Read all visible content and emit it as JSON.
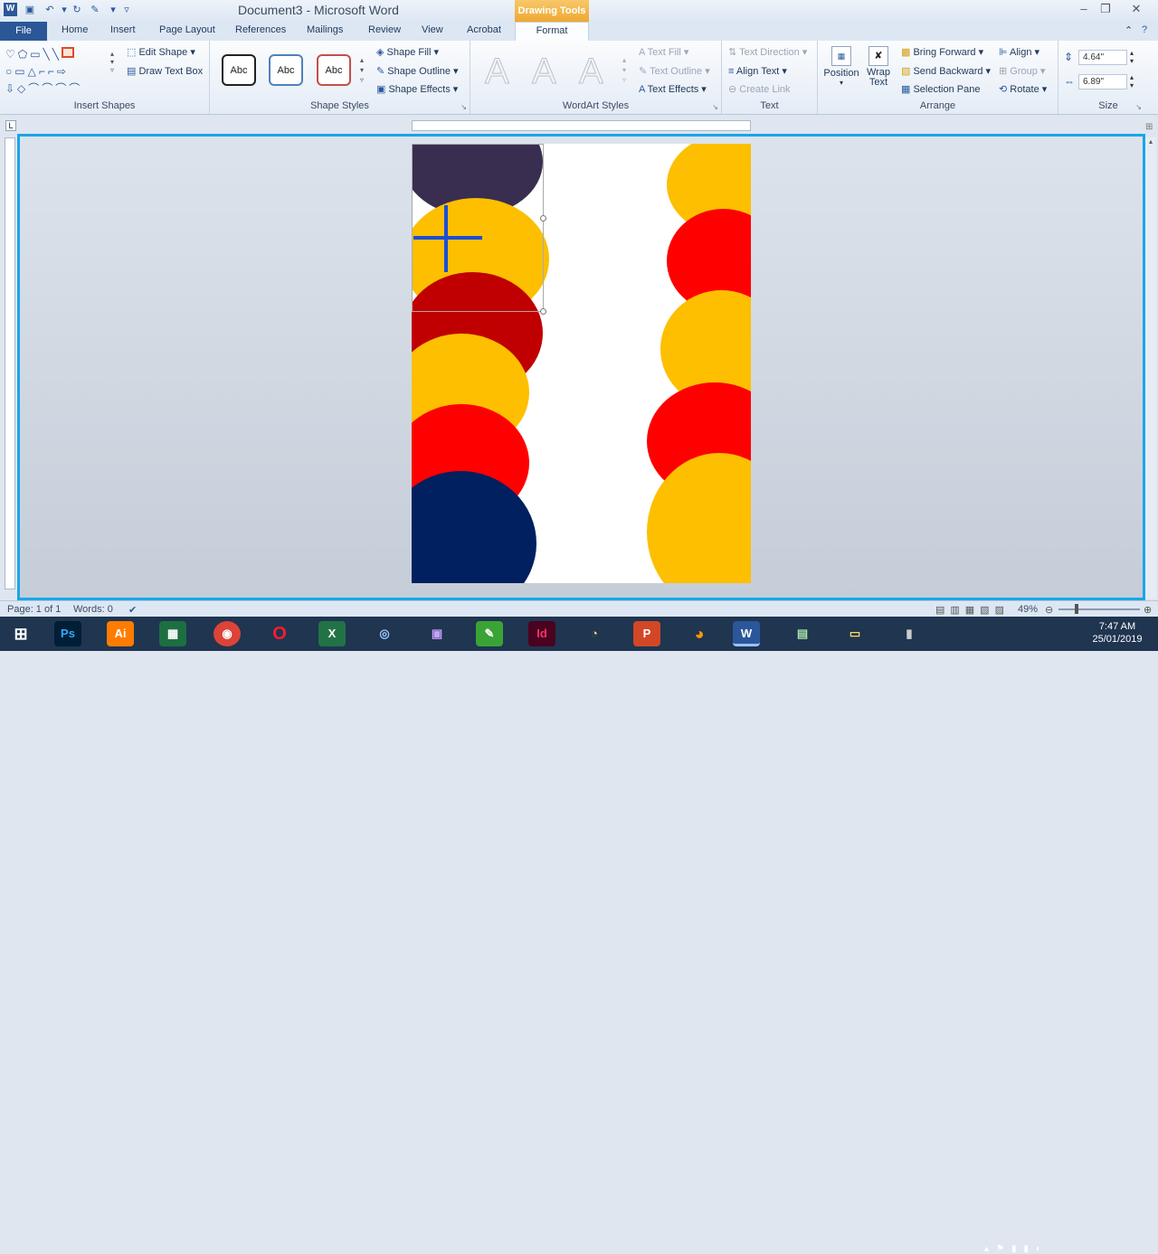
{
  "window": {
    "title": "Document3 - Microsoft Word",
    "context_tab": "Drawing Tools"
  },
  "tabs": [
    "File",
    "Home",
    "Insert",
    "Page Layout",
    "References",
    "Mailings",
    "Review",
    "View",
    "Acrobat",
    "Format"
  ],
  "ribbon": {
    "insert_shapes": {
      "label": "Insert Shapes",
      "edit_shape": "Edit Shape",
      "draw_text_box": "Draw Text Box"
    },
    "shape_styles": {
      "label": "Shape Styles",
      "samples": [
        "Abc",
        "Abc",
        "Abc"
      ],
      "fill": "Shape Fill",
      "outline": "Shape Outline",
      "effects": "Shape Effects"
    },
    "wordart_styles": {
      "label": "WordArt Styles",
      "samples": [
        "A",
        "A",
        "A"
      ],
      "text_fill": "Text Fill",
      "text_outline": "Text Outline",
      "text_effects": "Text Effects"
    },
    "text": {
      "label": "Text",
      "direction": "Text Direction",
      "align": "Align Text",
      "link": "Create Link"
    },
    "arrange": {
      "label": "Arrange",
      "position": "Position",
      "wrap_text": "Wrap Text",
      "bring_forward": "Bring Forward",
      "send_backward": "Send Backward",
      "selection_pane": "Selection Pane",
      "align": "Align",
      "group": "Group",
      "rotate": "Rotate"
    },
    "size": {
      "label": "Size",
      "height": "4.64\"",
      "width": "6.89\""
    }
  },
  "status": {
    "page": "Page: 1 of 1",
    "words": "Words: 0",
    "zoom": "49%"
  },
  "clock": {
    "time": "7:47 AM",
    "date": "25/01/2019"
  },
  "taskbar_apps": [
    "Ps",
    "Ai",
    "Id",
    "W"
  ],
  "colors": {
    "navy": "#392e4f",
    "yellow": "#fdbf00",
    "darkred": "#c00000",
    "red": "#ff0000",
    "blue": "#002060",
    "accent": "#1aa5e8"
  }
}
